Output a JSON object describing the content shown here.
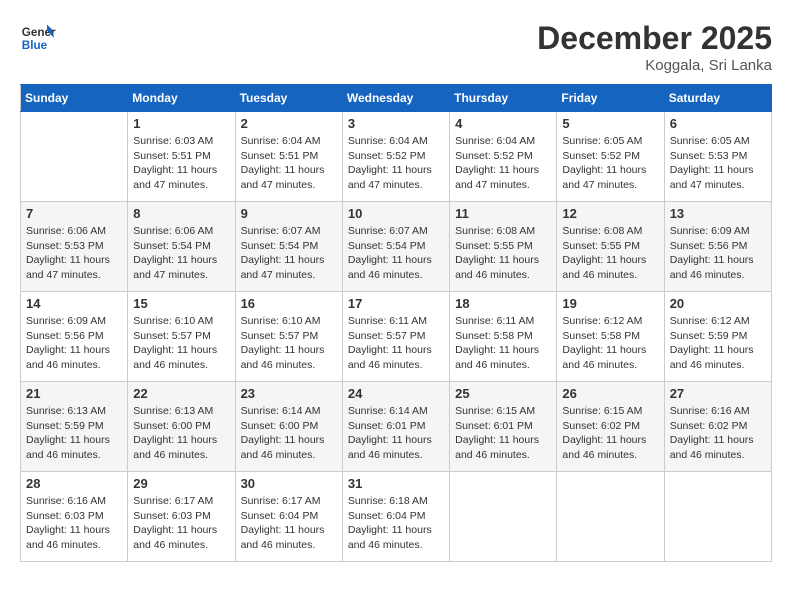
{
  "header": {
    "logo_line1": "General",
    "logo_line2": "Blue",
    "month": "December 2025",
    "location": "Koggala, Sri Lanka"
  },
  "days_of_week": [
    "Sunday",
    "Monday",
    "Tuesday",
    "Wednesday",
    "Thursday",
    "Friday",
    "Saturday"
  ],
  "weeks": [
    [
      {
        "day": "",
        "info": ""
      },
      {
        "day": "1",
        "info": "Sunrise: 6:03 AM\nSunset: 5:51 PM\nDaylight: 11 hours\nand 47 minutes."
      },
      {
        "day": "2",
        "info": "Sunrise: 6:04 AM\nSunset: 5:51 PM\nDaylight: 11 hours\nand 47 minutes."
      },
      {
        "day": "3",
        "info": "Sunrise: 6:04 AM\nSunset: 5:52 PM\nDaylight: 11 hours\nand 47 minutes."
      },
      {
        "day": "4",
        "info": "Sunrise: 6:04 AM\nSunset: 5:52 PM\nDaylight: 11 hours\nand 47 minutes."
      },
      {
        "day": "5",
        "info": "Sunrise: 6:05 AM\nSunset: 5:52 PM\nDaylight: 11 hours\nand 47 minutes."
      },
      {
        "day": "6",
        "info": "Sunrise: 6:05 AM\nSunset: 5:53 PM\nDaylight: 11 hours\nand 47 minutes."
      }
    ],
    [
      {
        "day": "7",
        "info": "Sunrise: 6:06 AM\nSunset: 5:53 PM\nDaylight: 11 hours\nand 47 minutes."
      },
      {
        "day": "8",
        "info": "Sunrise: 6:06 AM\nSunset: 5:54 PM\nDaylight: 11 hours\nand 47 minutes."
      },
      {
        "day": "9",
        "info": "Sunrise: 6:07 AM\nSunset: 5:54 PM\nDaylight: 11 hours\nand 47 minutes."
      },
      {
        "day": "10",
        "info": "Sunrise: 6:07 AM\nSunset: 5:54 PM\nDaylight: 11 hours\nand 46 minutes."
      },
      {
        "day": "11",
        "info": "Sunrise: 6:08 AM\nSunset: 5:55 PM\nDaylight: 11 hours\nand 46 minutes."
      },
      {
        "day": "12",
        "info": "Sunrise: 6:08 AM\nSunset: 5:55 PM\nDaylight: 11 hours\nand 46 minutes."
      },
      {
        "day": "13",
        "info": "Sunrise: 6:09 AM\nSunset: 5:56 PM\nDaylight: 11 hours\nand 46 minutes."
      }
    ],
    [
      {
        "day": "14",
        "info": "Sunrise: 6:09 AM\nSunset: 5:56 PM\nDaylight: 11 hours\nand 46 minutes."
      },
      {
        "day": "15",
        "info": "Sunrise: 6:10 AM\nSunset: 5:57 PM\nDaylight: 11 hours\nand 46 minutes."
      },
      {
        "day": "16",
        "info": "Sunrise: 6:10 AM\nSunset: 5:57 PM\nDaylight: 11 hours\nand 46 minutes."
      },
      {
        "day": "17",
        "info": "Sunrise: 6:11 AM\nSunset: 5:57 PM\nDaylight: 11 hours\nand 46 minutes."
      },
      {
        "day": "18",
        "info": "Sunrise: 6:11 AM\nSunset: 5:58 PM\nDaylight: 11 hours\nand 46 minutes."
      },
      {
        "day": "19",
        "info": "Sunrise: 6:12 AM\nSunset: 5:58 PM\nDaylight: 11 hours\nand 46 minutes."
      },
      {
        "day": "20",
        "info": "Sunrise: 6:12 AM\nSunset: 5:59 PM\nDaylight: 11 hours\nand 46 minutes."
      }
    ],
    [
      {
        "day": "21",
        "info": "Sunrise: 6:13 AM\nSunset: 5:59 PM\nDaylight: 11 hours\nand 46 minutes."
      },
      {
        "day": "22",
        "info": "Sunrise: 6:13 AM\nSunset: 6:00 PM\nDaylight: 11 hours\nand 46 minutes."
      },
      {
        "day": "23",
        "info": "Sunrise: 6:14 AM\nSunset: 6:00 PM\nDaylight: 11 hours\nand 46 minutes."
      },
      {
        "day": "24",
        "info": "Sunrise: 6:14 AM\nSunset: 6:01 PM\nDaylight: 11 hours\nand 46 minutes."
      },
      {
        "day": "25",
        "info": "Sunrise: 6:15 AM\nSunset: 6:01 PM\nDaylight: 11 hours\nand 46 minutes."
      },
      {
        "day": "26",
        "info": "Sunrise: 6:15 AM\nSunset: 6:02 PM\nDaylight: 11 hours\nand 46 minutes."
      },
      {
        "day": "27",
        "info": "Sunrise: 6:16 AM\nSunset: 6:02 PM\nDaylight: 11 hours\nand 46 minutes."
      }
    ],
    [
      {
        "day": "28",
        "info": "Sunrise: 6:16 AM\nSunset: 6:03 PM\nDaylight: 11 hours\nand 46 minutes."
      },
      {
        "day": "29",
        "info": "Sunrise: 6:17 AM\nSunset: 6:03 PM\nDaylight: 11 hours\nand 46 minutes."
      },
      {
        "day": "30",
        "info": "Sunrise: 6:17 AM\nSunset: 6:04 PM\nDaylight: 11 hours\nand 46 minutes."
      },
      {
        "day": "31",
        "info": "Sunrise: 6:18 AM\nSunset: 6:04 PM\nDaylight: 11 hours\nand 46 minutes."
      },
      {
        "day": "",
        "info": ""
      },
      {
        "day": "",
        "info": ""
      },
      {
        "day": "",
        "info": ""
      }
    ]
  ]
}
